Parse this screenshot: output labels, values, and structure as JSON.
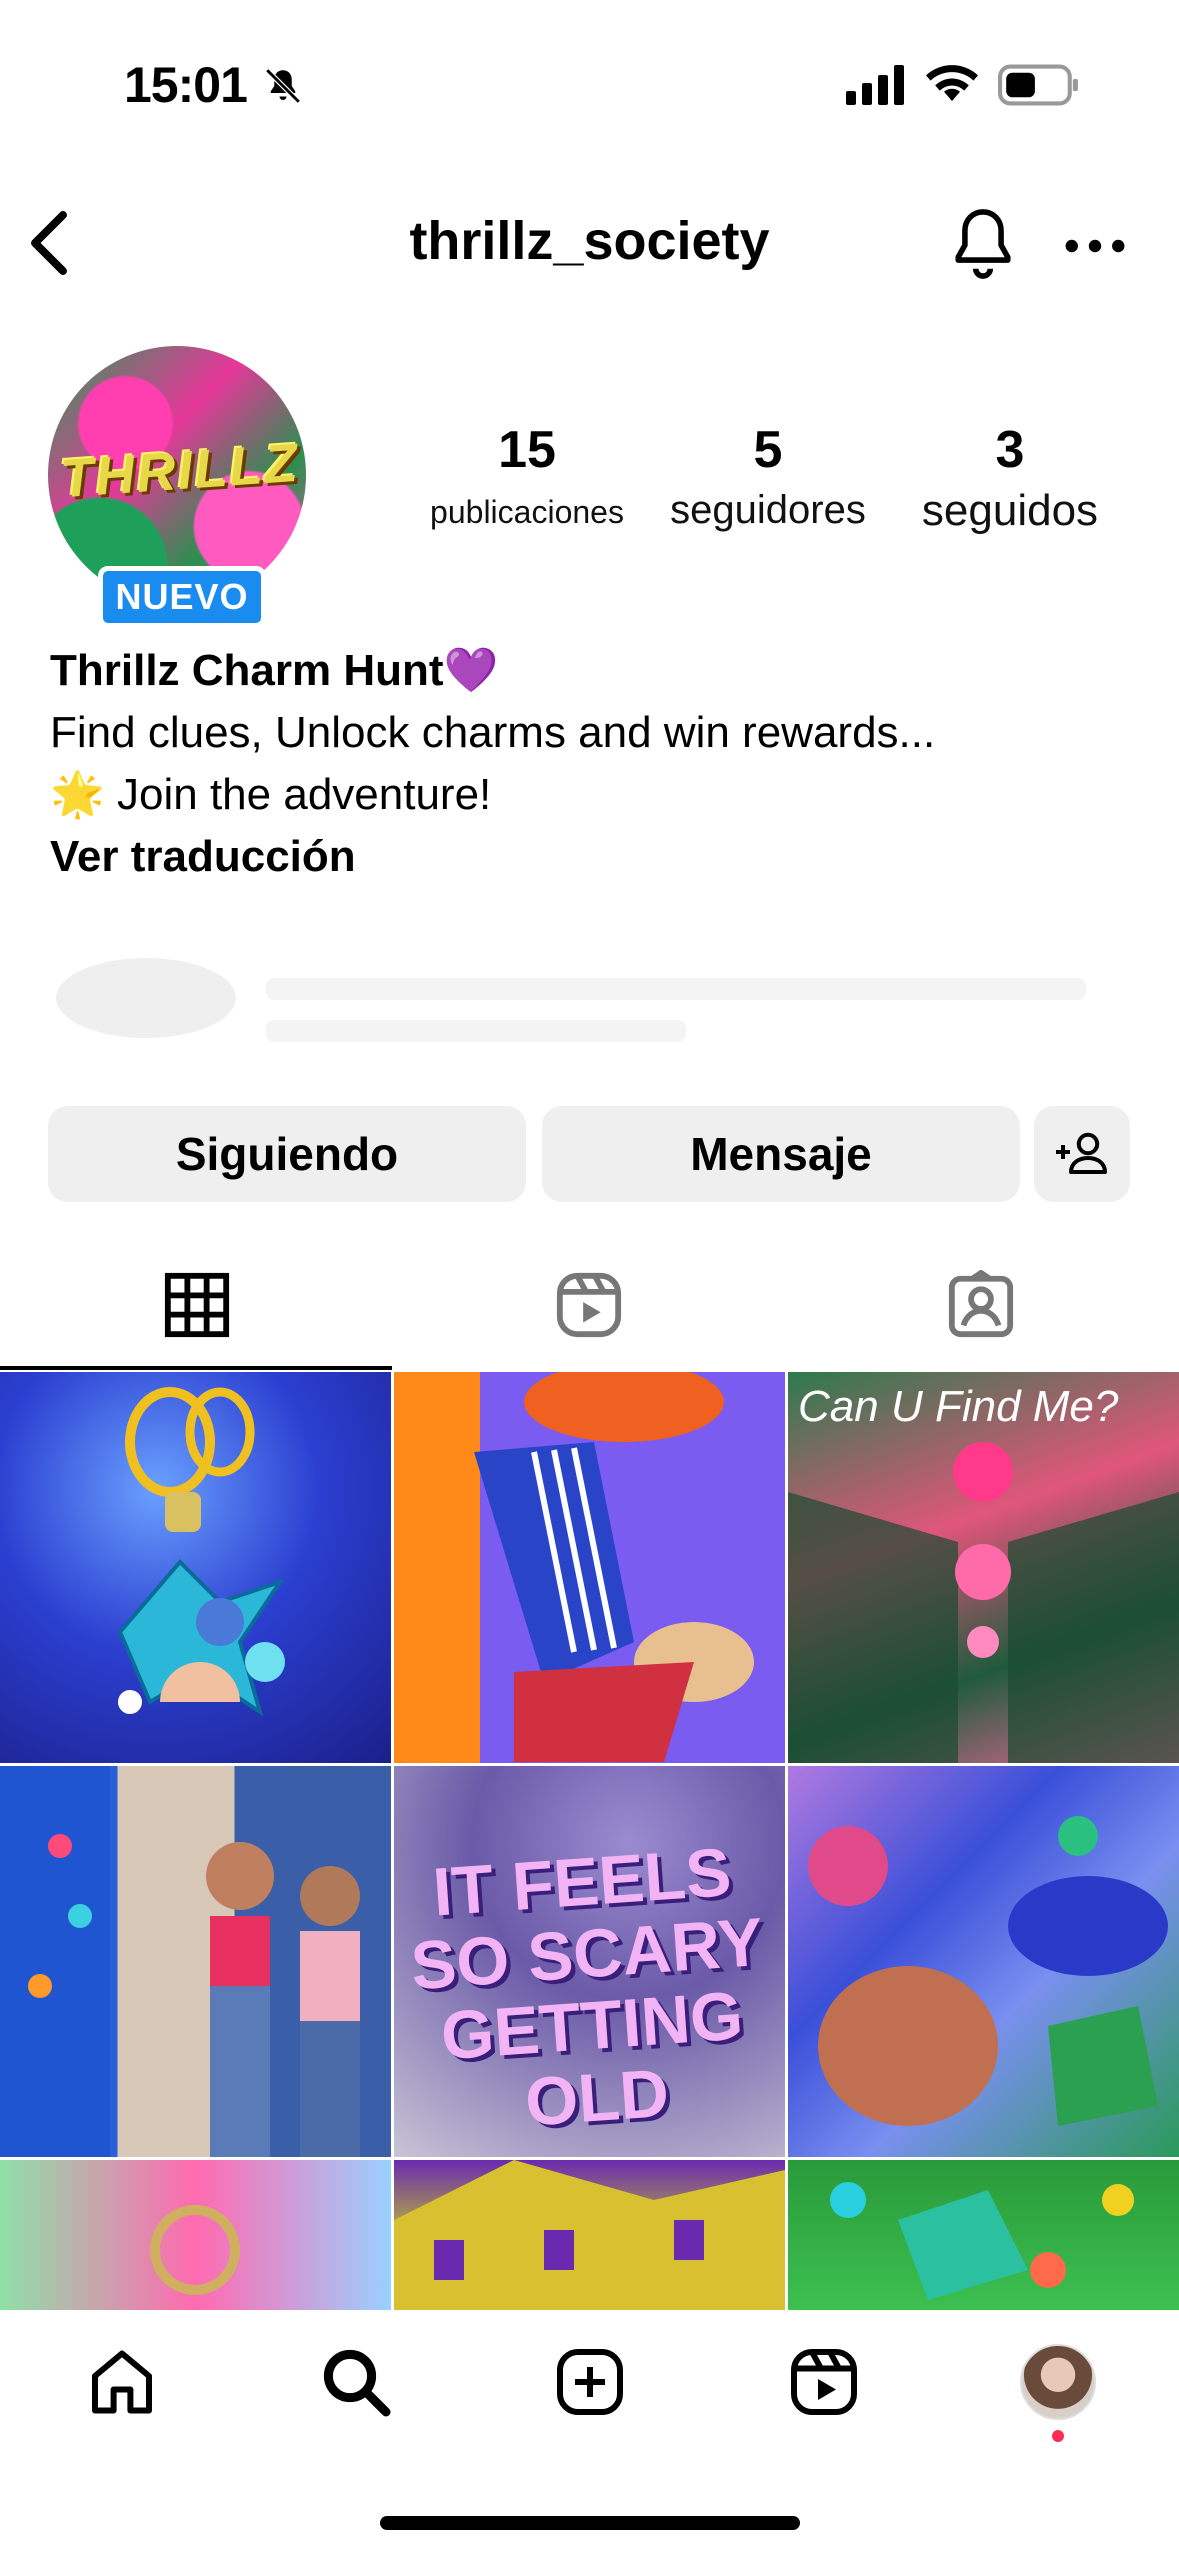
{
  "status": {
    "time": "15:01"
  },
  "nav": {
    "username": "thrillz_society"
  },
  "profile": {
    "avatar_text": "THRILLZ",
    "badge": "NUEVO",
    "stats": [
      {
        "value": "15",
        "label": "publicaciones"
      },
      {
        "value": "5",
        "label": "seguidores"
      },
      {
        "value": "3",
        "label": "seguidos"
      }
    ],
    "bio": {
      "name": "Thrillz Charm Hunt💜",
      "line1": "Find clues, Unlock charms and win rewards...",
      "line2": "🌟 Join the adventure!",
      "translate": "Ver traducción"
    }
  },
  "actions": {
    "following": "Siguiendo",
    "message": "Mensaje"
  },
  "tabs": [
    "grid-icon",
    "reels-icon",
    "tagged-icon"
  ],
  "grid": {
    "tile3_text": "Can U Find Me?",
    "tile5_text": "IT FEELS SO SCARY GETTING OLD"
  },
  "bottom_nav": [
    "home-icon",
    "search-icon",
    "create-icon",
    "reels-icon",
    "profile-avatar"
  ]
}
